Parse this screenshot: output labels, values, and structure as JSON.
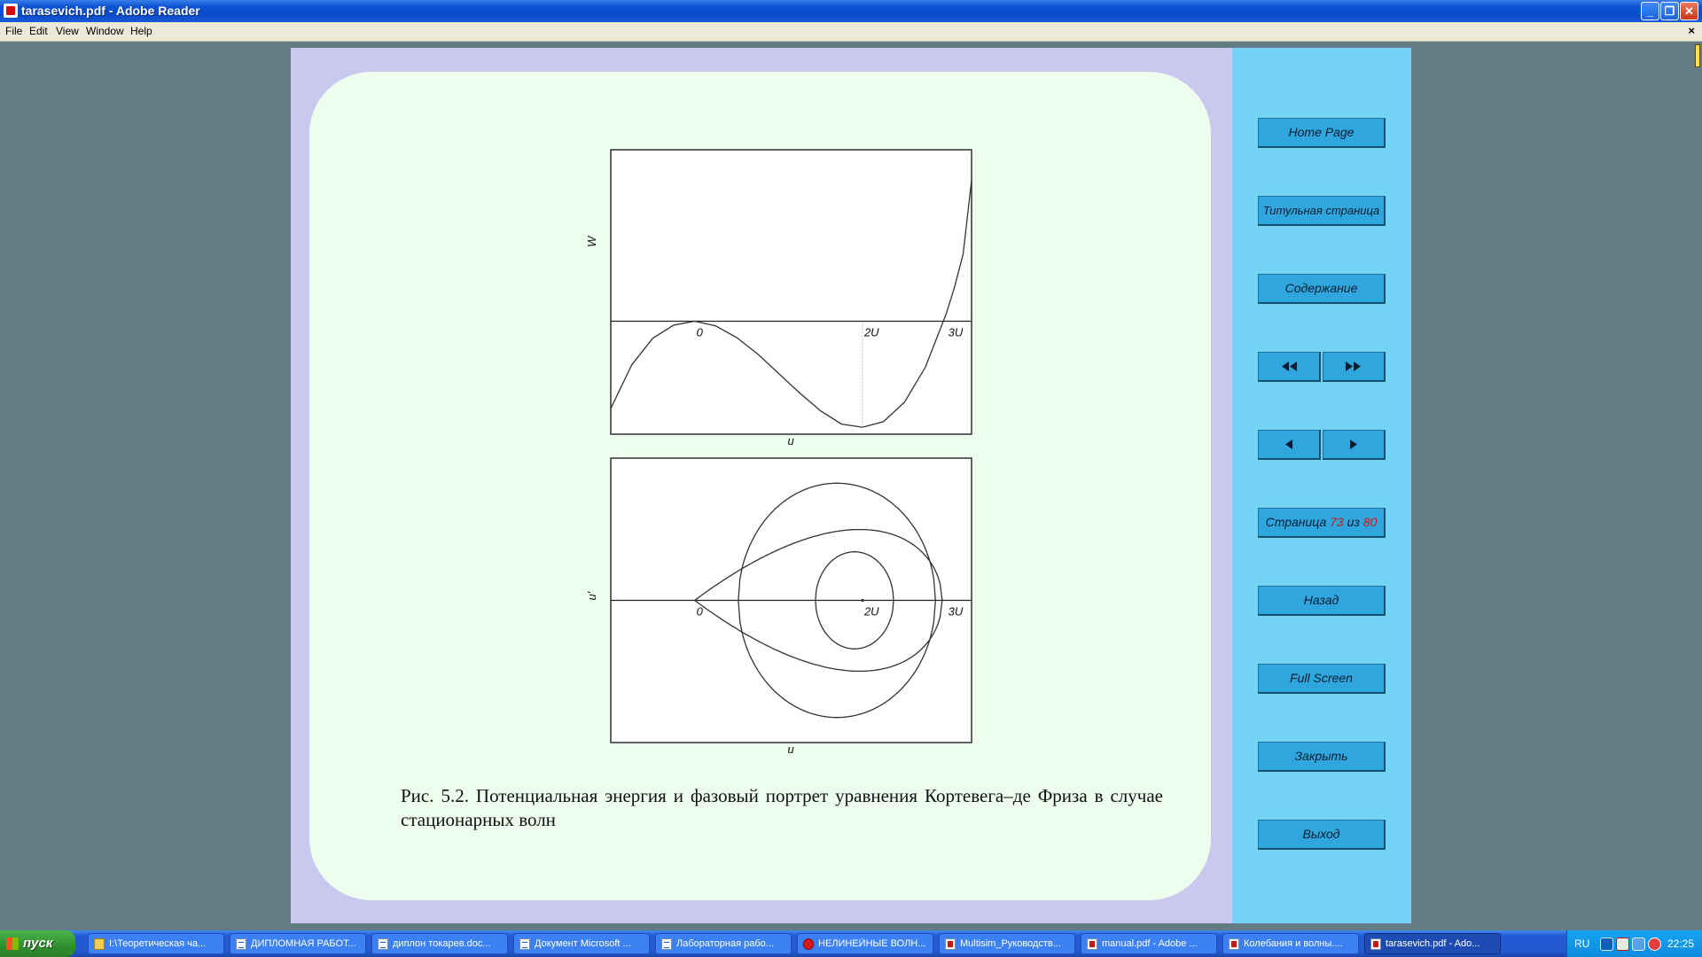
{
  "window": {
    "title": "tarasevich.pdf - Adobe Reader",
    "controls": {
      "minimize": "_",
      "maximize": "❐",
      "close": "✕"
    }
  },
  "menu": {
    "items": [
      "File",
      "Edit",
      "View",
      "Window",
      "Help"
    ],
    "close": "×"
  },
  "document": {
    "caption": "Рис. 5.2. Потенциальная энергия и фазовый портрет уравнения Кортевега–де Фриза в случае стационарных волн"
  },
  "chart_data": [
    {
      "type": "line",
      "description_of": "potential energy plot",
      "ylabel": "W",
      "xlabel": "u",
      "xlim": [
        -1,
        3.3
      ],
      "ylim": [
        -1.45,
        2.2
      ],
      "x_tick_labels": [
        "0",
        "2U",
        "3U"
      ],
      "x_tick_values": [
        0,
        2,
        3
      ],
      "series": [
        {
          "x": [
            -1,
            -0.75,
            -0.5,
            -0.25,
            0,
            0.25,
            0.5,
            0.75,
            1,
            1.25,
            1.5,
            1.75,
            2,
            2.25,
            2.5,
            2.75,
            3,
            3.1,
            3.2,
            3.3
          ],
          "y": [
            -1.12,
            -0.56,
            -0.22,
            -0.05,
            0,
            -0.06,
            -0.21,
            -0.42,
            -0.67,
            -0.92,
            -1.15,
            -1.32,
            -1.36,
            -1.29,
            -1.04,
            -0.59,
            0.1,
            0.45,
            0.86,
            1.81
          ]
        }
      ]
    },
    {
      "type": "line",
      "description_of": "phase portrait",
      "ylabel": "u'",
      "xlabel": "u",
      "xlim": [
        -1,
        3.3
      ],
      "ylim": [
        -1.7,
        1.7
      ],
      "x_tick_labels": [
        "0",
        "2U",
        "3U"
      ],
      "x_tick_values": [
        0,
        2,
        3
      ],
      "series": [
        {
          "kind": "separatrix",
          "u_left": 0,
          "u_right": 2.95,
          "amplitude": 1.32
        },
        {
          "kind": "orbit",
          "u_left": 0.52,
          "u_right": 2.87,
          "amplitude": 1.4
        },
        {
          "kind": "orbit",
          "u_left": 1.44,
          "u_right": 2.37,
          "amplitude": 0.58
        }
      ]
    }
  ],
  "sidebar": {
    "home": "Home Page",
    "title_page": "Титульная страница",
    "contents": "Содержание",
    "page_prefix": "Страница",
    "page_current": "73",
    "page_sep": "из",
    "page_total": "80",
    "back": "Назад",
    "fullscreen": "Full Screen",
    "close": "Закрыть",
    "exit": "Выход"
  },
  "taskbar": {
    "start": "пуск",
    "tasks": [
      "I:\\Теоретическая ча...",
      "ДИПЛОМНАЯ РАБОТ...",
      "диплон токарев.doc...",
      "Документ Microsoft ...",
      "Лабораторная рабо...",
      "НЕЛИНЕЙНЫЕ ВОЛН...",
      "Multisim_Руководств...",
      "manual.pdf - Adobe ...",
      "Колебания и волны....",
      "tarasevich.pdf - Ado..."
    ],
    "lang": "RU",
    "clock": "22:25"
  }
}
